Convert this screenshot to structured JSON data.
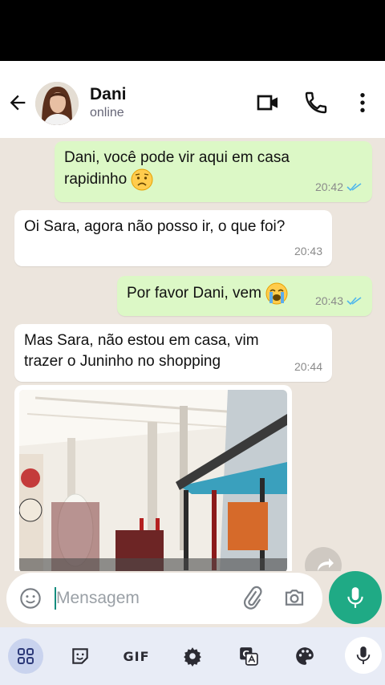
{
  "header": {
    "contact_name": "Dani",
    "status": "online"
  },
  "messages": [
    {
      "direction": "out",
      "lines": [
        "Dani, você pode vir aqui em casa",
        "rapidinho"
      ],
      "emoji": "worried-face",
      "time": "20:42",
      "read": true
    },
    {
      "direction": "in",
      "lines": [
        "Oi Sara, agora não posso ir, o que foi?"
      ],
      "time": "20:43"
    },
    {
      "direction": "out",
      "lines": [
        "Por favor Dani, vem"
      ],
      "emoji": "loudly-crying-face",
      "time": "20:43",
      "read": true
    },
    {
      "direction": "in",
      "lines": [
        "Mas Sara, não estou em casa, vim",
        "trazer o Juninho no shopping"
      ],
      "time": "20:44"
    }
  ],
  "composer": {
    "placeholder": "Mensagem"
  },
  "keyboard_toolbar": {
    "gif_label": "GIF"
  },
  "colors": {
    "outgoing_bubble": "#dcf8c6",
    "incoming_bubble": "#ffffff",
    "chat_background": "#ece5dd",
    "accent_green": "#1faa85",
    "read_ticks": "#4fb6ec"
  }
}
